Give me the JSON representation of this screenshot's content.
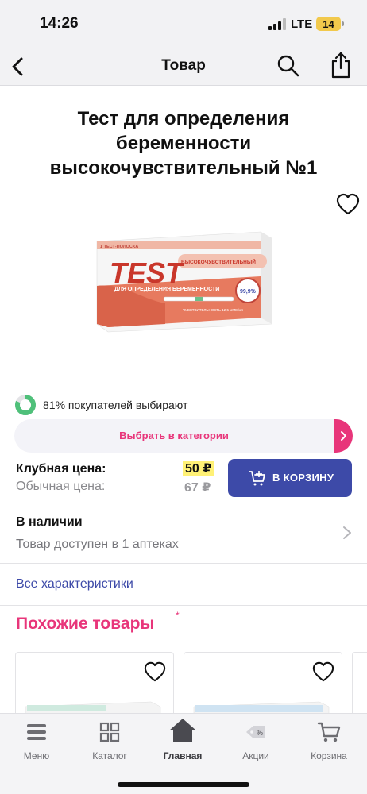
{
  "status_bar": {
    "time": "14:26",
    "network": "LTE",
    "battery": "14"
  },
  "nav": {
    "title": "Товар",
    "icons": [
      "back-icon",
      "search-icon",
      "share-icon"
    ]
  },
  "product": {
    "title": "Тест для определения беременности высокочувствительный №1",
    "package": {
      "brand": "TEST",
      "strip_count": "1 ТЕСТ-ПОЛОСКА",
      "subtitle": "ДЛЯ ОПРЕДЕЛЕНИЯ БЕРЕМЕННОСТИ",
      "badge": "ВЫСОКОЧУВСТВИТЕЛЬНЫЙ",
      "accuracy": "99,9%",
      "sensitivity": "ЧУВСТВИТЕЛЬНОСТЬ 12,5 мМЕ/мл"
    }
  },
  "popularity": {
    "text": "81% покупателей выбирают",
    "percent": 81
  },
  "category_button": {
    "label": "Выбрать в категории"
  },
  "prices": {
    "club_label": "Клубная цена:",
    "club_value": "50 ₽",
    "regular_label": "Обычная цена:",
    "regular_value": "67 ₽"
  },
  "cart_button": {
    "label": "В КОРЗИНУ"
  },
  "stock": {
    "title": "В наличии",
    "subtitle": "Товар доступен в 1 аптеках"
  },
  "all_specs": "Все характеристики",
  "similar": {
    "title": "Похожие товары",
    "marker": "*"
  },
  "tab_bar": {
    "items": [
      {
        "label": "Меню",
        "icon": "menu-icon"
      },
      {
        "label": "Каталог",
        "icon": "catalog-icon"
      },
      {
        "label": "Главная",
        "icon": "home-icon"
      },
      {
        "label": "Акции",
        "icon": "sale-tag-icon"
      },
      {
        "label": "Корзина",
        "icon": "cart-icon"
      }
    ],
    "active": "Главная"
  },
  "colors": {
    "accent_pink": "#e8357a",
    "brand_blue": "#3d4aa8",
    "price_highlight": "#fff176",
    "package_salmon": "#e77a5f"
  }
}
